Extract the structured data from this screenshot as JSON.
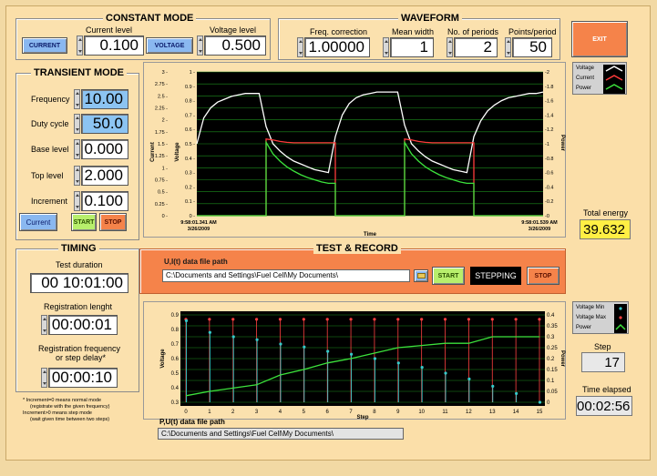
{
  "constant_mode": {
    "title": "CONSTANT MODE",
    "current_level_label": "Current level",
    "current_level": "0.100",
    "voltage_level_label": "Voltage level",
    "voltage_level": "0.500",
    "current_btn": "CURRENT",
    "voltage_btn": "VOLTAGE"
  },
  "waveform": {
    "title": "WAVEFORM",
    "freq_label": "Freq. correction",
    "freq": "1.00000",
    "mean_label": "Mean width",
    "mean": "1",
    "periods_label": "No. of  periods",
    "periods": "2",
    "ppp_label": "Points/period",
    "ppp": "50"
  },
  "exit_btn": "EXIT",
  "transient_mode": {
    "title": "TRANSIENT MODE",
    "frequency_label": "Frequency",
    "frequency": "10.00",
    "duty_label": "Duty cycle",
    "duty": "50.0",
    "base_label": "Base level",
    "base": "0.000",
    "top_label": "Top level",
    "top": "2.000",
    "increment_label": "Increment",
    "increment": "0.100",
    "mode_selector": "Current",
    "start_btn": "START",
    "stop_btn": "STOP"
  },
  "timing": {
    "title": "TIMING",
    "test_duration_label": "Test duration",
    "test_duration": "00 10:01:00",
    "reg_length_label": "Registration lenght",
    "reg_length": "00:00:01",
    "reg_freq_label_1": "Registration frequency",
    "reg_freq_label_2": "or step delay*",
    "reg_freq": "00:00:10",
    "footnote_1": "* Increment=0 means normal mode",
    "footnote_2": "(registrate with the given frequency)",
    "footnote_3": "Increment>0 means step mode",
    "footnote_4": "(wait given time between two steps)"
  },
  "test_record": {
    "title": "TEST & RECORD",
    "ui_path_label": "U,I(t) data file path",
    "ui_path": "C:\\Documents and Settings\\Fuel Cell\\My Documents\\",
    "start_btn": "START",
    "status": "STEPPING",
    "stop_btn": "STOP"
  },
  "pu_path_label": "P,U(t) data file path",
  "pu_path": "C:\\Documents and Settings\\Fuel Cell\\My Documents\\",
  "total_energy_label": "Total energy",
  "total_energy": "39.632",
  "step_label": "Step",
  "step": "17",
  "time_elapsed_label": "Time elapsed",
  "time_elapsed": "00:02:56",
  "legend_top": [
    "Voltage",
    "Current",
    "Power"
  ],
  "legend_bottom": [
    "Voltage Min",
    "Voltage Max",
    "Power"
  ],
  "colors": {
    "voltage": "#ffffff",
    "current": "#ff3b3b",
    "power": "#3ce23c",
    "vmin": "#35c9c9",
    "vmax": "#ff4040",
    "accent_orange": "#f5834a",
    "background": "#fbdfa9"
  },
  "chart_data": [
    {
      "type": "line",
      "title": "",
      "xlabel": "Time",
      "ylabel_left_outer": "Current",
      "ylabel_left_inner": "Voltage",
      "ylabel_right": "Power",
      "x_start_label": [
        "9:58:01.341 AM",
        "3/26/2009"
      ],
      "x_end_label": [
        "9:58:01.539 AM",
        "3/26/2009"
      ],
      "current_ticks": [
        "3 -",
        "2.75 -",
        "2.5 -",
        "2.25 -",
        "2 -",
        "1.75 -",
        "1.5 -",
        "1.25 -",
        "1 -",
        "0.75 -",
        "0.5 -",
        "0.25 -",
        "0 -"
      ],
      "voltage_ticks": [
        "1",
        "0.9",
        "0.8",
        "0.7",
        "0.6",
        "0.5",
        "0.4",
        "0.3",
        "0.2",
        "0.1",
        "0"
      ],
      "power_ticks": [
        "-2",
        "-1.8",
        "-1.6",
        "-1.4",
        "-1.2",
        "-1",
        "-0.8",
        "-0.6",
        "-0.4",
        "-0.2",
        "-0"
      ],
      "current_ylim": [
        0,
        3
      ],
      "voltage_ylim": [
        0,
        1
      ],
      "power_ylim": [
        0,
        2
      ],
      "grid": true,
      "x": [
        0,
        0.02,
        0.04,
        0.06,
        0.08,
        0.1,
        0.12,
        0.14,
        0.16,
        0.18,
        0.2,
        0.22,
        0.24,
        0.26,
        0.28,
        0.3,
        0.32,
        0.34,
        0.36,
        0.38,
        0.4,
        0.42,
        0.44,
        0.46,
        0.48,
        0.5,
        0.52,
        0.54,
        0.56,
        0.58,
        0.6,
        0.62,
        0.64,
        0.66,
        0.68,
        0.7,
        0.72,
        0.74,
        0.76,
        0.78,
        0.8,
        0.82,
        0.84,
        0.86,
        0.88,
        0.9,
        0.92,
        0.94,
        0.96,
        0.98,
        1.0
      ],
      "series": [
        {
          "name": "Voltage",
          "values": [
            0.5,
            0.68,
            0.75,
            0.79,
            0.81,
            0.83,
            0.84,
            0.85,
            0.85,
            0.85,
            0.62,
            0.5,
            0.45,
            0.41,
            0.38,
            0.36,
            0.34,
            0.32,
            0.31,
            0.3,
            0.55,
            0.7,
            0.78,
            0.82,
            0.84,
            0.85,
            0.86,
            0.86,
            0.86,
            0.86,
            0.63,
            0.5,
            0.45,
            0.41,
            0.38,
            0.36,
            0.34,
            0.32,
            0.31,
            0.3,
            0.55,
            0.66,
            0.73,
            0.77,
            0.8,
            0.82,
            0.83,
            0.84,
            0.85,
            0.85,
            0.86
          ]
        },
        {
          "name": "Current",
          "values": [
            0,
            0,
            0,
            0,
            0,
            0,
            0,
            0,
            0,
            0,
            1.6,
            1.58,
            1.55,
            1.53,
            1.52,
            1.52,
            1.52,
            1.52,
            1.52,
            1.52,
            0,
            0,
            0,
            0,
            0,
            0,
            0,
            0,
            0,
            0,
            1.6,
            1.58,
            1.55,
            1.53,
            1.52,
            1.52,
            1.52,
            1.52,
            1.52,
            1.52,
            0,
            0,
            0,
            0,
            0,
            0,
            0,
            0,
            0,
            0,
            0
          ]
        },
        {
          "name": "Power",
          "values": [
            0,
            0,
            0,
            0,
            0,
            0,
            0,
            0,
            0,
            0,
            1.02,
            0.86,
            0.76,
            0.68,
            0.62,
            0.57,
            0.53,
            0.5,
            0.47,
            0.45,
            0,
            0,
            0,
            0,
            0,
            0,
            0,
            0,
            0,
            0,
            1.02,
            0.86,
            0.76,
            0.68,
            0.62,
            0.57,
            0.53,
            0.5,
            0.47,
            0.45,
            0,
            0,
            0,
            0,
            0,
            0,
            0,
            0,
            0,
            0,
            0
          ]
        }
      ]
    },
    {
      "type": "line",
      "title": "",
      "xlabel": "Step",
      "ylabel_left": "Voltage",
      "ylabel_right": "Power",
      "x_ticks": [
        "0",
        "1",
        "2",
        "3",
        "4",
        "5",
        "6",
        "7",
        "8",
        "9",
        "10",
        "11",
        "12",
        "13",
        "14",
        "15"
      ],
      "voltage_ticks": [
        "0.9",
        "0.8",
        "0.7",
        "0.6",
        "0.5",
        "0.4",
        "0.3"
      ],
      "power_ticks": [
        "0.4",
        "0.35",
        "0.3",
        "0.25",
        "0.2",
        "0.15",
        "0.1",
        "0.05",
        "0"
      ],
      "xlim": [
        0,
        15
      ],
      "voltage_ylim": [
        0.3,
        0.9
      ],
      "power_ylim": [
        0,
        0.4
      ],
      "grid": true,
      "x": [
        0,
        1,
        2,
        3,
        4,
        5,
        6,
        7,
        8,
        9,
        10,
        11,
        12,
        13,
        14,
        15
      ],
      "series": [
        {
          "name": "Voltage Min",
          "values": [
            0.86,
            0.78,
            0.75,
            0.73,
            0.7,
            0.68,
            0.65,
            0.63,
            0.6,
            0.57,
            0.54,
            0.5,
            0.46,
            0.41,
            0.36,
            0.3
          ]
        },
        {
          "name": "Voltage Max",
          "values": [
            0.87,
            0.87,
            0.87,
            0.87,
            0.87,
            0.87,
            0.87,
            0.87,
            0.87,
            0.87,
            0.87,
            0.87,
            0.87,
            0.87,
            0.87,
            0.87
          ]
        },
        {
          "name": "Power",
          "values": [
            0.03,
            0.05,
            0.065,
            0.08,
            0.125,
            0.15,
            0.18,
            0.2,
            0.225,
            0.25,
            0.26,
            0.27,
            0.27,
            0.3,
            0.3,
            0.3
          ]
        }
      ]
    }
  ]
}
